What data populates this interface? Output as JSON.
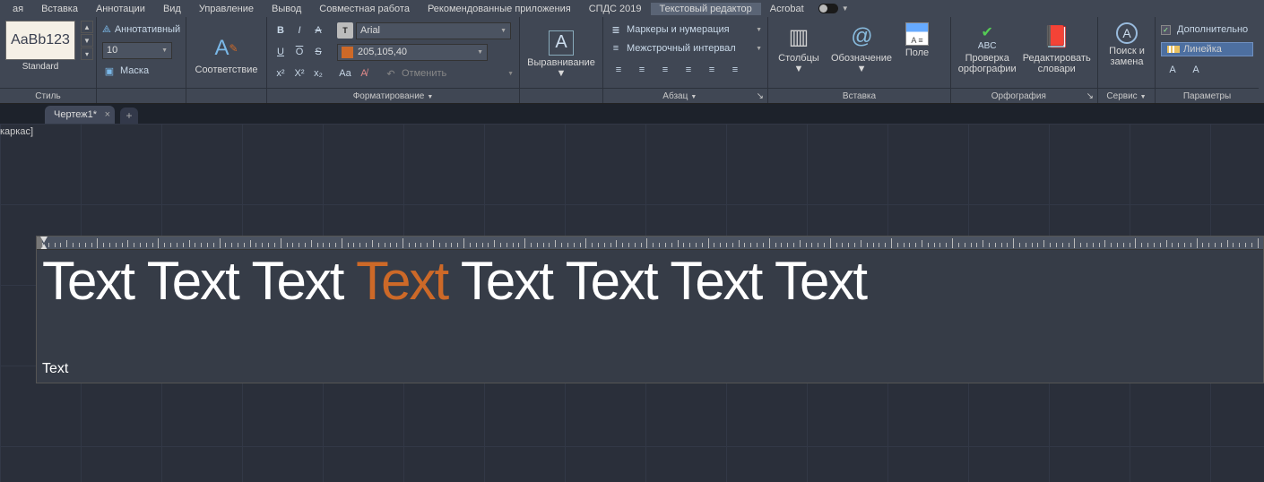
{
  "menu": {
    "items": [
      "ая",
      "Вставка",
      "Аннотации",
      "Вид",
      "Управление",
      "Вывод",
      "Совместная работа",
      "Рекомендованные приложения",
      "СПДС 2019",
      "Текстовый редактор",
      "Acrobat"
    ],
    "active": 9
  },
  "style": {
    "preview": "AaBb123",
    "name": "Standard",
    "annot": "Аннотативный",
    "size": "10",
    "mask": "Маска",
    "panel": "Стиль"
  },
  "fmt": {
    "match": "Соответствие",
    "font": "Arial",
    "color": "205,105,40",
    "undo": "Отменить",
    "panel": "Форматирование",
    "b": "B",
    "i": "I",
    "a_strike": "A",
    "u": "U",
    "o": "O",
    "s": "S",
    "x2": "x²",
    "x2b": "X²",
    "x2c": "x₂",
    "aa": "Aa"
  },
  "align": {
    "big": "Выравнивание",
    "bullets": "Маркеры и нумерация",
    "spacing": "Межстрочный интервал",
    "panel": "Абзац"
  },
  "ins": {
    "cols": "Столбцы",
    "sym": "Обозначение",
    "field": "Поле",
    "panel": "Вставка"
  },
  "spell": {
    "check": "Проверка\nорфографии",
    "dict": "Редактировать\nсловари",
    "panel": "Орфография"
  },
  "tools": {
    "find": "Поиск и\nзамена",
    "panel": "Сервис"
  },
  "opts": {
    "extra": "Дополнительно",
    "ruler": "Линейка",
    "panel": "Параметры"
  },
  "tab": {
    "name": "Чертеж1*"
  },
  "canvas": {
    "bracket": "каркас]",
    "word": "Text",
    "cursor": "Text"
  }
}
